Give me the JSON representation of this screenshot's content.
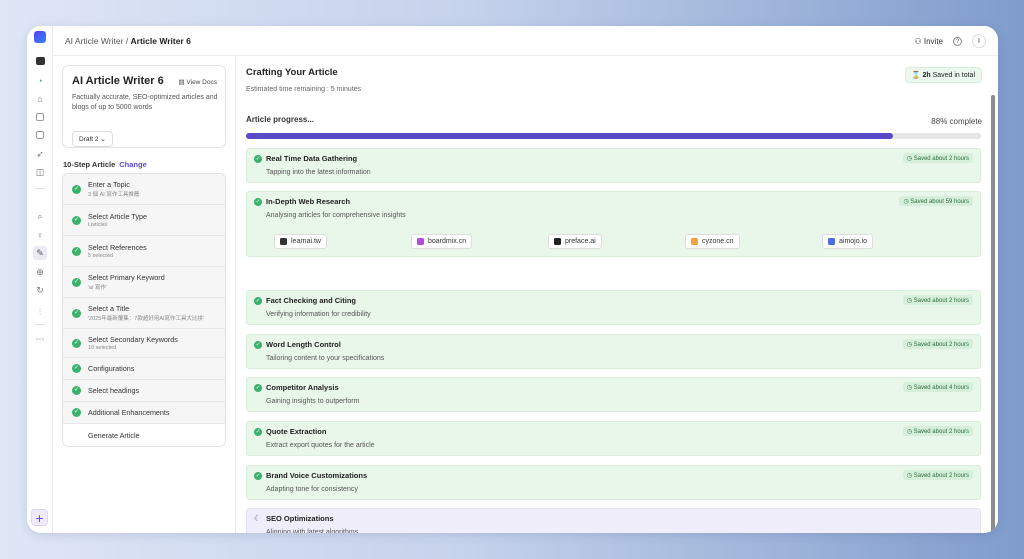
{
  "breadcrumb": {
    "parent": "AI Article Writer",
    "separator": " / ",
    "current": "Article Writer 6"
  },
  "topbar": {
    "invite_label": "Invite",
    "help_glyph": "?",
    "avatar_initial": "I"
  },
  "info_card": {
    "title": "AI Article Writer 6",
    "view_docs": "View Docs",
    "description": "Factually accurate, SEO-optimized articles and blogs of up to 5000 words",
    "draft_label": "Draft 2"
  },
  "steps_header": {
    "label": "10-Step Article",
    "change_label": "Change"
  },
  "steps": [
    {
      "label": "Enter a Topic",
      "sub": "3 個 AI 寫作工具推薦",
      "done": true
    },
    {
      "label": "Select Article Type",
      "sub": "Listicles",
      "done": true
    },
    {
      "label": "Select References",
      "sub": "5 selected",
      "done": true
    },
    {
      "label": "Select Primary Keyword",
      "sub": "'ai 寫作'",
      "done": true
    },
    {
      "label": "Select a Title",
      "sub": "'2025年最新覆集：7款超好用AI寫作工具大比拼'",
      "done": true
    },
    {
      "label": "Select Secondary Keywords",
      "sub": "10 selected",
      "done": true
    },
    {
      "label": "Configurations",
      "sub": "",
      "done": true
    },
    {
      "label": "Select headings",
      "sub": "",
      "done": true
    },
    {
      "label": "Additional Enhancements",
      "sub": "",
      "done": true
    },
    {
      "label": "Generate Article",
      "sub": "",
      "done": false
    }
  ],
  "main": {
    "title": "Crafting Your Article",
    "estimate": "Estimated time remaining : 5 minutes",
    "saved_total_time": "2h",
    "saved_total_text": "Saved in total",
    "progress_label": "Article progress...",
    "progress_value": 88,
    "progress_text": "88% complete"
  },
  "tasks": [
    {
      "name": "Real Time Data Gathering",
      "desc": "Tapping into the latest information",
      "saved": "Saved about 2 hours",
      "status": "done"
    },
    {
      "name": "In-Depth Web Research",
      "desc": "Analysing articles for comprehensive insights",
      "saved": "Saved about 59 hours",
      "status": "done"
    },
    {
      "name": "Fact Checking and Citing",
      "desc": "Verifying information for credibility",
      "saved": "Saved about 2 hours",
      "status": "done"
    },
    {
      "name": "Word Length Control",
      "desc": "Tailoring content to your specifications",
      "saved": "Saved about 2 hours",
      "status": "done"
    },
    {
      "name": "Competitor Analysis",
      "desc": "Gaining insights to outperform",
      "saved": "Saved about 4 hours",
      "status": "done"
    },
    {
      "name": "Quote Extraction",
      "desc": "Extract export quotes for the article",
      "saved": "Saved about 2 hours",
      "status": "done"
    },
    {
      "name": "Brand Voice Customizations",
      "desc": "Adapting tone for consistency",
      "saved": "Saved about 2 hours",
      "status": "done"
    },
    {
      "name": "SEO Optimizations",
      "desc": "Aligning with latest algorithms",
      "saved": "",
      "status": "pending"
    }
  ],
  "sources": [
    {
      "label": "learnai.tw",
      "color": "#333333"
    },
    {
      "label": "boardmix.cn",
      "color": "#b24de0"
    },
    {
      "label": "preface.ai",
      "color": "#222222"
    },
    {
      "label": "cyzone.cn",
      "color": "#f2a33a"
    },
    {
      "label": "aimojo.io",
      "color": "#4a6ee0"
    }
  ],
  "colors": {
    "accent": "#5b4ac6",
    "success": "#3bb26c",
    "task_bg": "#e8f7ea"
  }
}
